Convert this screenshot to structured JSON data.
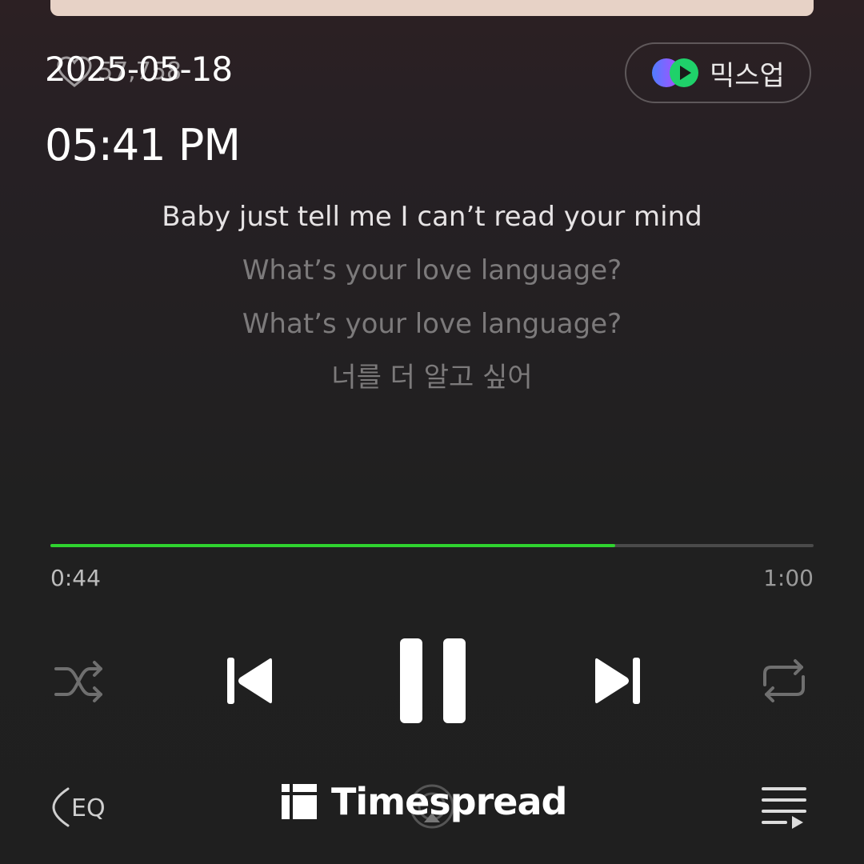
{
  "header": {
    "like_count": "57,758",
    "date": "2025-05-18",
    "time": "05:41 PM",
    "mixup_label": "믹스업"
  },
  "lyrics": [
    "Baby just tell me I can’t read your mind",
    "What’s your love language?",
    "What’s your love language?",
    "너를 더 알고 싶어"
  ],
  "player": {
    "progress_fraction": 0.74,
    "current_time": "0:44",
    "total_time": "1:00",
    "accent_color": "#2fd32f"
  },
  "watermark": {
    "text": "Timespread"
  },
  "icons": {
    "like": "heart-icon",
    "mixup": "mixup-icon",
    "shuffle": "shuffle-icon",
    "previous": "skip-previous-icon",
    "pause": "pause-icon",
    "next": "skip-next-icon",
    "repeat": "repeat-icon",
    "eq": "equalizer-icon",
    "cast": "cast-icon",
    "queue": "playlist-icon"
  }
}
